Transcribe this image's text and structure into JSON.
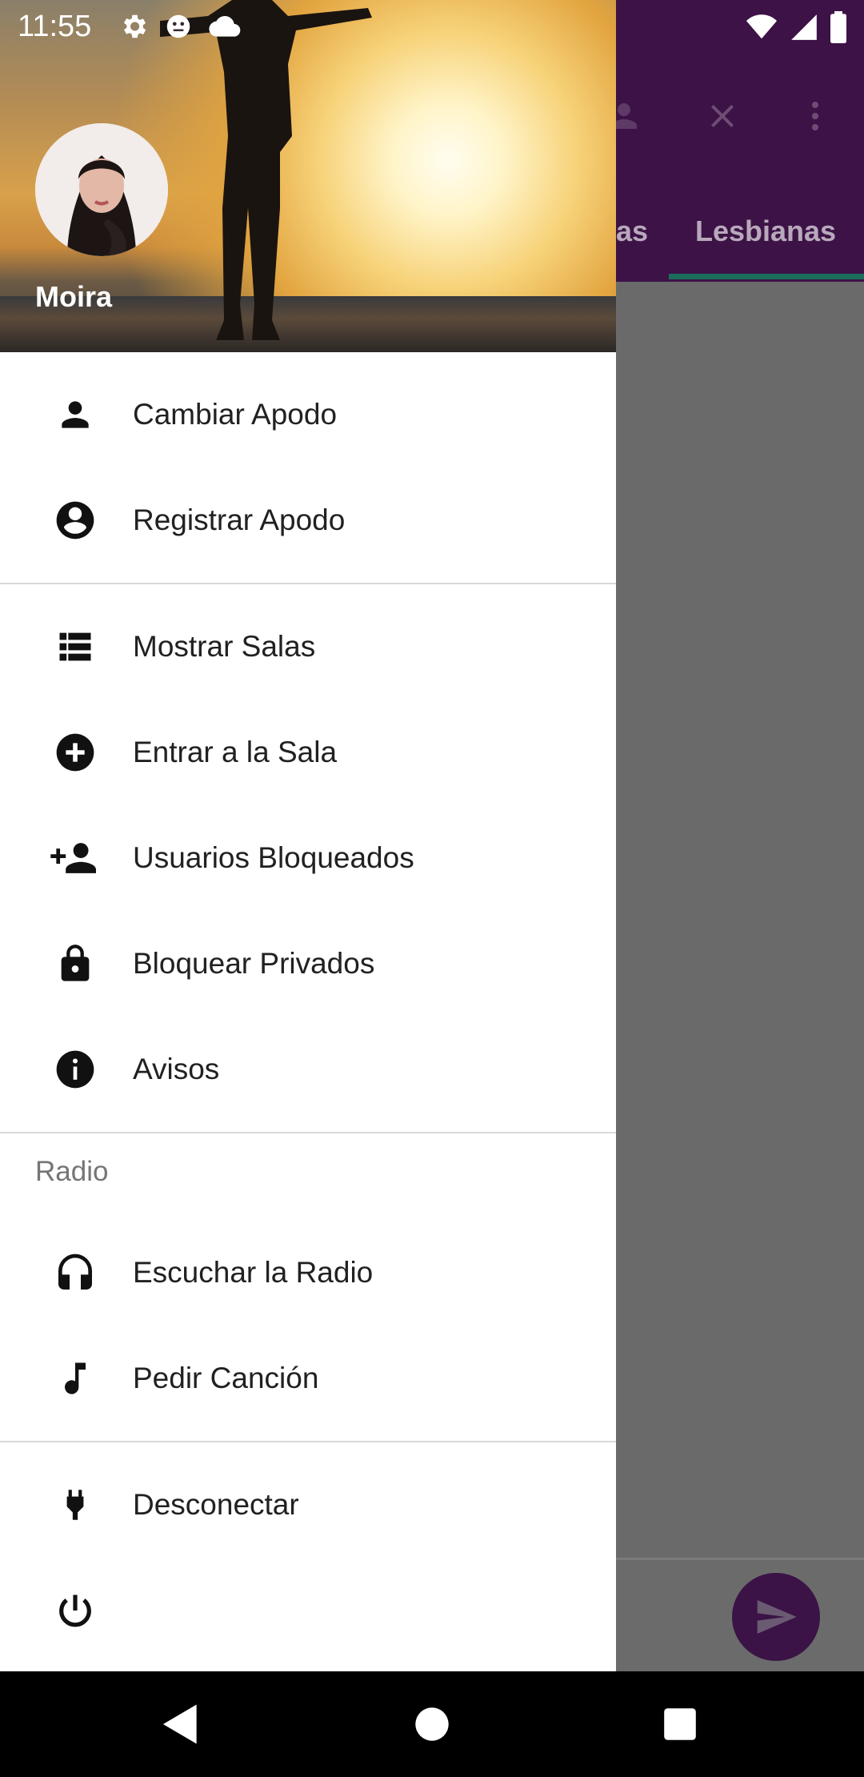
{
  "status_bar": {
    "time": "11:55",
    "left_icons": [
      "settings-icon",
      "assistant-icon",
      "cloud-icon"
    ],
    "right_icons": [
      "wifi-icon",
      "signal-icon",
      "battery-icon"
    ]
  },
  "background_app": {
    "toolbar_icons": [
      "person-icon",
      "close-icon",
      "more-vert-icon"
    ],
    "tabs": [
      {
        "label": "as"
      },
      {
        "label": "Lesbianas"
      }
    ],
    "accent": "#3d1247",
    "tab_indicator_color": "#1a6e5a"
  },
  "drawer": {
    "user_name": "Moira",
    "sections": [
      {
        "items": [
          {
            "icon": "person-icon",
            "label": "Cambiar Apodo"
          },
          {
            "icon": "account-circle-icon",
            "label": "Registrar Apodo"
          }
        ]
      },
      {
        "items": [
          {
            "icon": "list-icon",
            "label": "Mostrar Salas"
          },
          {
            "icon": "add-circle-icon",
            "label": "Entrar a la Sala"
          },
          {
            "icon": "person-add-icon",
            "label": "Usuarios Bloqueados"
          },
          {
            "icon": "lock-icon",
            "label": "Bloquear Privados"
          },
          {
            "icon": "info-icon",
            "label": "Avisos"
          }
        ]
      },
      {
        "title": "Radio",
        "items": [
          {
            "icon": "headphones-icon",
            "label": "Escuchar la Radio"
          },
          {
            "icon": "music-note-icon",
            "label": "Pedir Canción"
          }
        ]
      },
      {
        "items": [
          {
            "icon": "power-plug-icon",
            "label": "Desconectar"
          }
        ]
      }
    ]
  },
  "nav_bar": {
    "buttons": [
      "back-icon",
      "home-icon",
      "recents-icon"
    ]
  }
}
